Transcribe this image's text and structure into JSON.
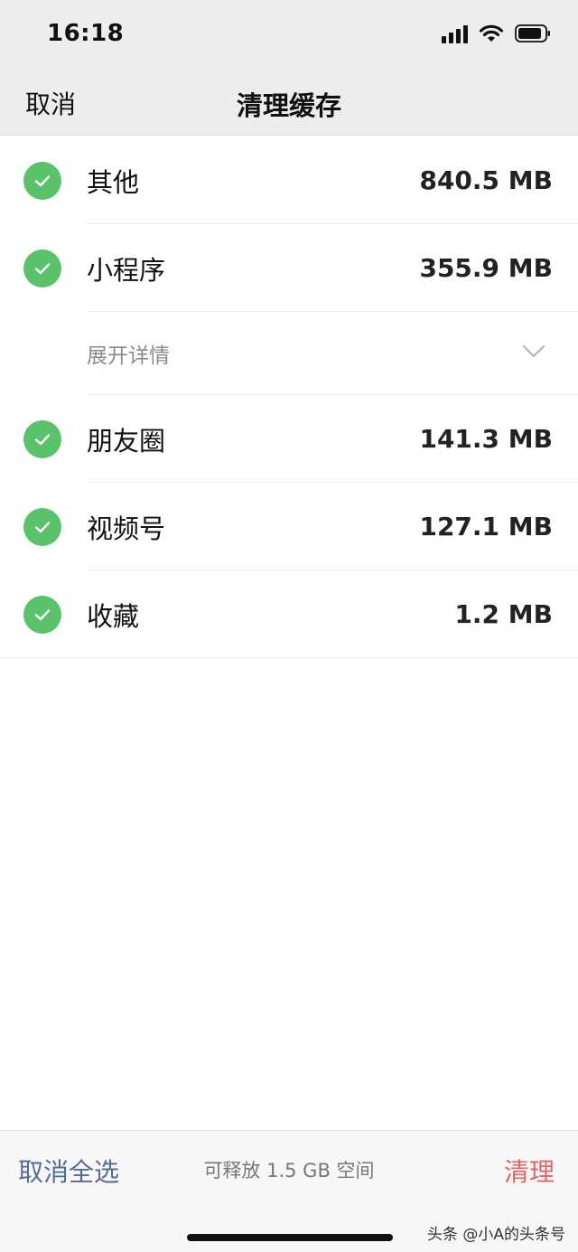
{
  "status_bar": {
    "time": "16:18"
  },
  "nav": {
    "cancel": "取消",
    "title": "清理缓存"
  },
  "items": [
    {
      "label": "其他",
      "size": "840.5 MB",
      "checked": true
    },
    {
      "label": "小程序",
      "size": "355.9 MB",
      "checked": true
    },
    {
      "label": "朋友圈",
      "size": "141.3 MB",
      "checked": true
    },
    {
      "label": "视频号",
      "size": "127.1 MB",
      "checked": true
    },
    {
      "label": "收藏",
      "size": "1.2 MB",
      "checked": true
    }
  ],
  "expand": {
    "label": "展开详情"
  },
  "bottom": {
    "deselect_all": "取消全选",
    "free_space": "可释放 1.5 GB 空间",
    "clean": "清理"
  },
  "watermark": "头条 @小A的头条号",
  "colors": {
    "check_green": "#5ac26a",
    "link_blue": "#566b94",
    "clean_red": "#e06666"
  }
}
